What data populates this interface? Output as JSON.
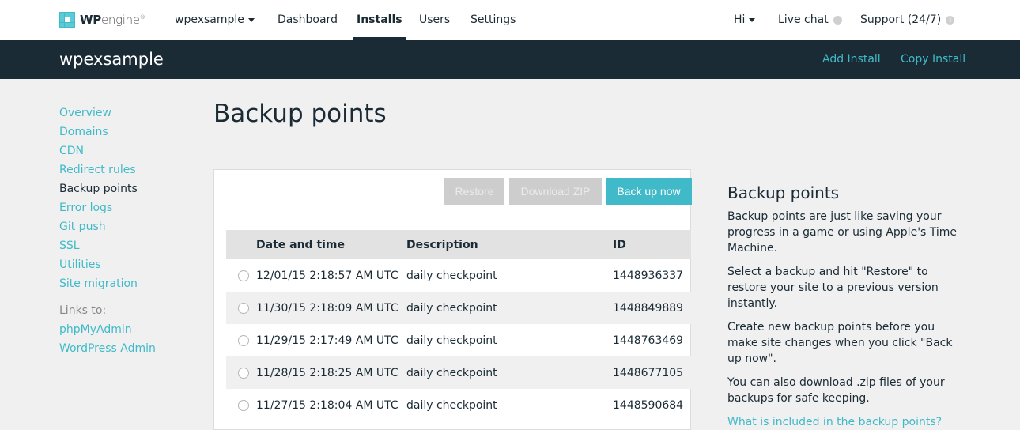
{
  "brand": {
    "logo_bold": "WP",
    "logo_light": "engine",
    "trademark": "®"
  },
  "colors": {
    "accent": "#40bac8",
    "dark": "#1a2b35",
    "disabled": "#cdcdcd"
  },
  "topnav": {
    "account": "wpexsample",
    "items": [
      "Dashboard",
      "Installs",
      "Users",
      "Settings"
    ],
    "active": "Installs",
    "greeting": "Hi",
    "live_chat": "Live chat",
    "support": "Support (24/7)"
  },
  "subheader": {
    "title": "wpexsample",
    "actions": [
      "Add Install",
      "Copy Install"
    ]
  },
  "sidebar": {
    "items": [
      "Overview",
      "Domains",
      "CDN",
      "Redirect rules",
      "Backup points",
      "Error logs",
      "Git push",
      "SSL",
      "Utilities",
      "Site migration"
    ],
    "current": "Backup points",
    "links_label": "Links to:",
    "links": [
      "phpMyAdmin",
      "WordPress Admin"
    ]
  },
  "main": {
    "title": "Backup points",
    "buttons": {
      "restore": "Restore",
      "download": "Download ZIP",
      "backup": "Back up now"
    },
    "table": {
      "headers": [
        "Date and time",
        "Description",
        "ID"
      ],
      "rows": [
        {
          "date": "12/01/15 2:18:57 AM UTC",
          "description": "daily checkpoint",
          "id": "1448936337",
          "selected": false
        },
        {
          "date": "11/30/15 2:18:09 AM UTC",
          "description": "daily checkpoint",
          "id": "1448849889",
          "selected": false
        },
        {
          "date": "11/29/15 2:17:49 AM UTC",
          "description": "daily checkpoint",
          "id": "1448763469",
          "selected": false
        },
        {
          "date": "11/28/15 2:18:25 AM UTC",
          "description": "daily checkpoint",
          "id": "1448677105",
          "selected": false
        },
        {
          "date": "11/27/15 2:18:04 AM UTC",
          "description": "daily checkpoint",
          "id": "1448590684",
          "selected": false
        }
      ]
    }
  },
  "help": {
    "title": "Backup points",
    "paragraphs": [
      "Backup points are just like saving your progress in a game or using Apple's Time Machine.",
      "Select a backup and hit \"Restore\" to restore your site to a previous version instantly.",
      "Create new backup points before you make site changes when you click \"Back up now\".",
      "You can also download .zip files of your backups for safe keeping."
    ],
    "link": "What is included in the backup points?"
  }
}
